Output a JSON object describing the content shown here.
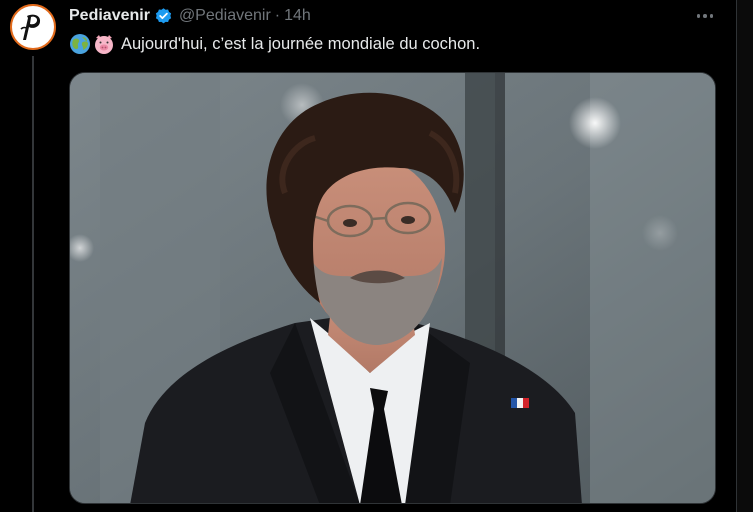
{
  "tweet": {
    "display_name": "Pediavenir",
    "handle": "@Pediavenir",
    "separator": "·",
    "time": "14h",
    "emojis": [
      "globe-earth-icon",
      "pig-face-icon"
    ],
    "text": "Aujourd'hui, c’est la journée mondiale du cochon.",
    "verified": true
  },
  "colors": {
    "background": "#000000",
    "text_primary": "#e7e9ea",
    "text_secondary": "#71767b",
    "verified_badge": "#1d9bf0",
    "avatar_ring": "#e26a1b",
    "border": "#2f3336"
  }
}
